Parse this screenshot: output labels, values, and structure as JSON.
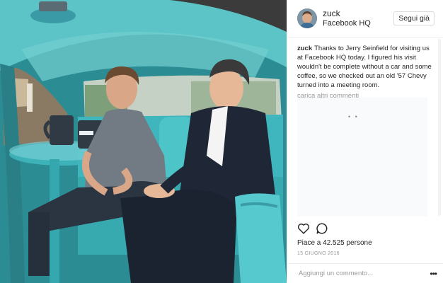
{
  "post": {
    "image_alt": "Two men seated in a turquoise vintage car interior with coffee mugs on a small round table"
  },
  "header": {
    "username": "zuck",
    "location": "Facebook HQ",
    "follow_label": "Segui già"
  },
  "caption": {
    "username": "zuck",
    "text": "Thanks to Jerry Seinfield for visiting us at Facebook HQ today. I figured his visit wouldn't be complete without a car and some coffee, so we checked out an old '57 Chevy turned into a meeting room."
  },
  "comments": {
    "load_more": "carica altri commenti"
  },
  "actions": {
    "like_icon": "heart-icon",
    "comment_icon": "comment-icon"
  },
  "likes": {
    "text": "Piace a 42.525 persone"
  },
  "date": {
    "text": "15 GIUGNO 2016"
  },
  "add_comment": {
    "placeholder": "Aggiungi un commento...",
    "options_icon": "more-options-icon"
  },
  "colors": {
    "accent_text": "#262626",
    "muted_text": "#999999",
    "border": "#efefef",
    "car_teal": "#3fb6bd"
  }
}
